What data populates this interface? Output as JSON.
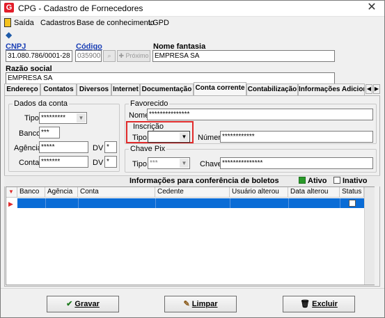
{
  "window": {
    "title": "CPG - Cadastro de Fornecedores",
    "close_glyph": "✕"
  },
  "app_icon_letter": "G",
  "menu": [
    "Saída",
    "Cadastros",
    "Base de conhecimento",
    "LGPD"
  ],
  "header": {
    "cnpj_label": "CNPJ",
    "cnpj_value": "31.080.786/0001-28",
    "codigo_label": "Código",
    "codigo_value": "035900",
    "proximo_label": "Próximo",
    "nome_fantasia_label": "Nome fantasia",
    "nome_fantasia_value": "EMPRESA SA",
    "razao_social_label": "Razão social",
    "razao_social_value": "EMPRESA SA"
  },
  "tabs": [
    "Endereço",
    "Contatos",
    "Diversos",
    "Internet",
    "Documentação",
    "Conta corrente",
    "Contabilização",
    "Informações Adiciona"
  ],
  "active_tab": "Conta corrente",
  "dados_conta": {
    "title": "Dados da conta",
    "tipo_label": "Tipo",
    "tipo_value": "*********",
    "banco_label": "Banco",
    "banco_value": "***",
    "agencia_label": "Agência",
    "agencia_value": "*****",
    "conta_label": "Conta",
    "conta_value": "*******",
    "dv_label": "DV",
    "dv_agencia_value": "*",
    "dv_conta_value": "*"
  },
  "favorecido": {
    "title": "Favorecido",
    "nome_label": "Nome",
    "nome_value": "***************",
    "inscricao_title": "Inscrição",
    "inscricao_tipo_label": "Tipo",
    "inscricao_tipo_value": "",
    "numero_label": "Número",
    "numero_value": "************"
  },
  "chave_pix": {
    "title": "Chave Pix",
    "tipo_label": "Tipo",
    "tipo_value": "***",
    "chave_label": "Chave",
    "chave_value": "***************"
  },
  "boletos": {
    "title": "Informações para conferência de boletos",
    "ativo_label": "Ativo",
    "inativo_label": "Inativo",
    "columns": [
      "Banco",
      "Agência",
      "Conta",
      "Cedente",
      "Usuário alterou",
      "Data alterou",
      "Status"
    ]
  },
  "buttons": {
    "gravar": "Gravar",
    "limpar": "Limpar",
    "excluir": "Excluir"
  },
  "colors": {
    "accent_red": "#e02a2a",
    "selection_blue": "#0a6cd6",
    "link_blue": "#1a3fb5",
    "ativo_green": "#2a9a2a"
  }
}
